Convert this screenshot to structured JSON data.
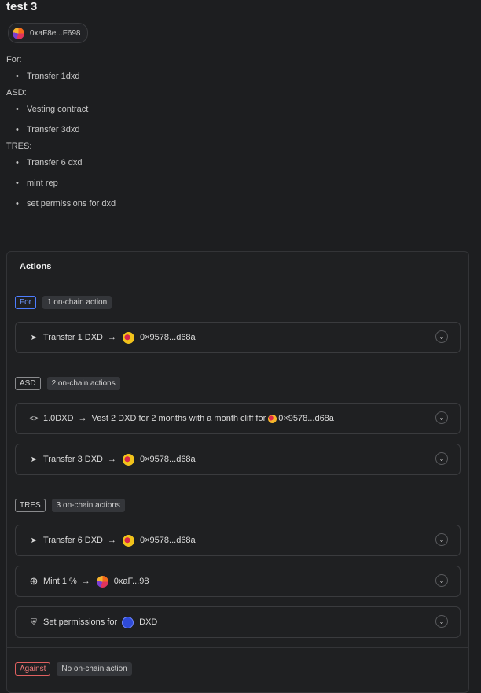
{
  "proposal": {
    "title": "test 3",
    "author": "0xaF8e...F698",
    "description": {
      "sections": [
        {
          "heading": "For:",
          "items": [
            "Transfer 1dxd"
          ]
        },
        {
          "heading": "ASD:",
          "items": [
            "Vesting contract",
            "Transfer 3dxd"
          ]
        },
        {
          "heading": "TRES:",
          "items": [
            "Transfer 6 dxd",
            "mint rep",
            "set permissions for dxd"
          ]
        }
      ]
    }
  },
  "actions": {
    "header": "Actions",
    "groups": [
      {
        "tag": "For",
        "count": "1 on-chain action",
        "rows": [
          {
            "icon": "send-icon",
            "label": "Transfer 1 DXD",
            "target": "0×9578...d68a"
          }
        ]
      },
      {
        "tag": "ASD",
        "count": "2 on-chain actions",
        "rows": [
          {
            "icon": "code-icon",
            "label": "1.0DXD",
            "detail": "Vest 2 DXD for 2 months with a month cliff for",
            "target": "0×9578...d68a"
          },
          {
            "icon": "send-icon",
            "label": "Transfer 3 DXD",
            "target": "0×9578...d68a"
          }
        ]
      },
      {
        "tag": "TRES",
        "count": "3 on-chain actions",
        "rows": [
          {
            "icon": "send-icon",
            "label": "Transfer 6 DXD",
            "target": "0×9578...d68a"
          },
          {
            "icon": "mint-icon",
            "label": "Mint 1 %",
            "target": "0xaF...98"
          },
          {
            "icon": "shield-icon",
            "label": "Set permissions for",
            "target": "DXD"
          }
        ]
      },
      {
        "tag": "Against",
        "count": "No on-chain action",
        "rows": []
      }
    ]
  },
  "arrow_glyph": "→",
  "colors": {
    "for": "#4d7dff",
    "against": "#e06060",
    "background": "#1d1e20"
  }
}
